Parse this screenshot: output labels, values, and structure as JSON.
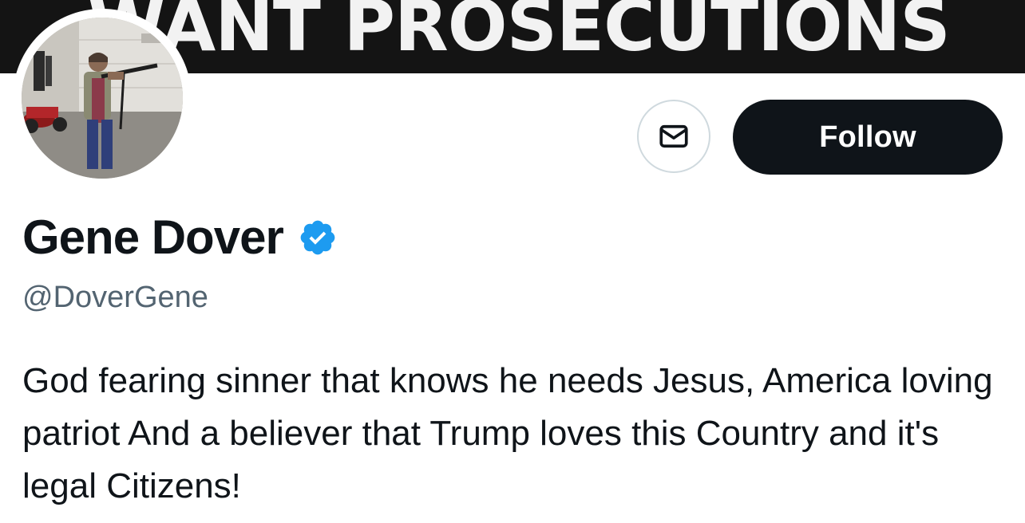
{
  "banner": {
    "text": "WANT PROSECUTIONS",
    "background": "#141414",
    "text_color": "#f2f2f2"
  },
  "profile": {
    "display_name": "Gene Dover",
    "handle": "@DoverGene",
    "bio": "God fearing sinner that knows he needs Jesus, America loving patriot And a believer that Trump loves this Country and it's legal Citizens!",
    "verified": true,
    "verified_color": "#1d9bf0"
  },
  "actions": {
    "message_icon": "envelope-icon",
    "follow_label": "Follow",
    "follow_bg": "#0f1419"
  },
  "avatar": {
    "icon": "profile-photo"
  }
}
